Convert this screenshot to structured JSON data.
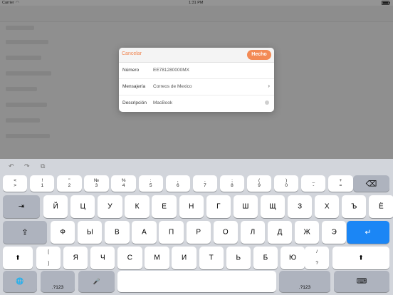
{
  "status_bar": {
    "carrier": "Carrier",
    "time": "1:31 PM"
  },
  "dialog": {
    "cancel_label": "Cancelar",
    "done_label": "Hecho",
    "rows": [
      {
        "label": "Número",
        "value": "EE781280000MX"
      },
      {
        "label": "Mensajería",
        "value": "Correos de Mexico"
      },
      {
        "label": "Descripción",
        "value": "MacBook"
      }
    ]
  },
  "keyboard": {
    "toolbar_icons": [
      "undo-icon",
      "redo-icon",
      "paste-icon"
    ],
    "number_row": [
      {
        "top": "<",
        "bottom": ">"
      },
      {
        "top": "!",
        "bottom": "1"
      },
      {
        "top": "\"",
        "bottom": "2"
      },
      {
        "top": "№",
        "bottom": "3"
      },
      {
        "top": "%",
        "bottom": "4"
      },
      {
        "top": ":",
        "bottom": "5"
      },
      {
        "top": ",",
        "bottom": "6"
      },
      {
        "top": ".",
        "bottom": "7"
      },
      {
        "top": ";",
        "bottom": "8"
      },
      {
        "top": "(",
        "bottom": "9"
      },
      {
        "top": ")",
        "bottom": "0"
      },
      {
        "top": "_",
        "bottom": "-"
      },
      {
        "top": "+",
        "bottom": "="
      }
    ],
    "row1": [
      "Й",
      "Ц",
      "У",
      "К",
      "Е",
      "Н",
      "Г",
      "Ш",
      "Щ",
      "З",
      "Х",
      "Ъ",
      "Ё"
    ],
    "row2": [
      "Ф",
      "Ы",
      "В",
      "А",
      "П",
      "Р",
      "О",
      "Л",
      "Д",
      "Ж",
      "Э"
    ],
    "row3_bracket": {
      "top": "[",
      "bottom": "]"
    },
    "row3": [
      "Я",
      "Ч",
      "С",
      "М",
      "И",
      "Т",
      "Ь",
      "Б",
      "Ю"
    ],
    "row3_slash": {
      "top": "/",
      "bottom": "?"
    },
    "numbers_label": ".?123",
    "numbers_label_right": ".?123"
  }
}
